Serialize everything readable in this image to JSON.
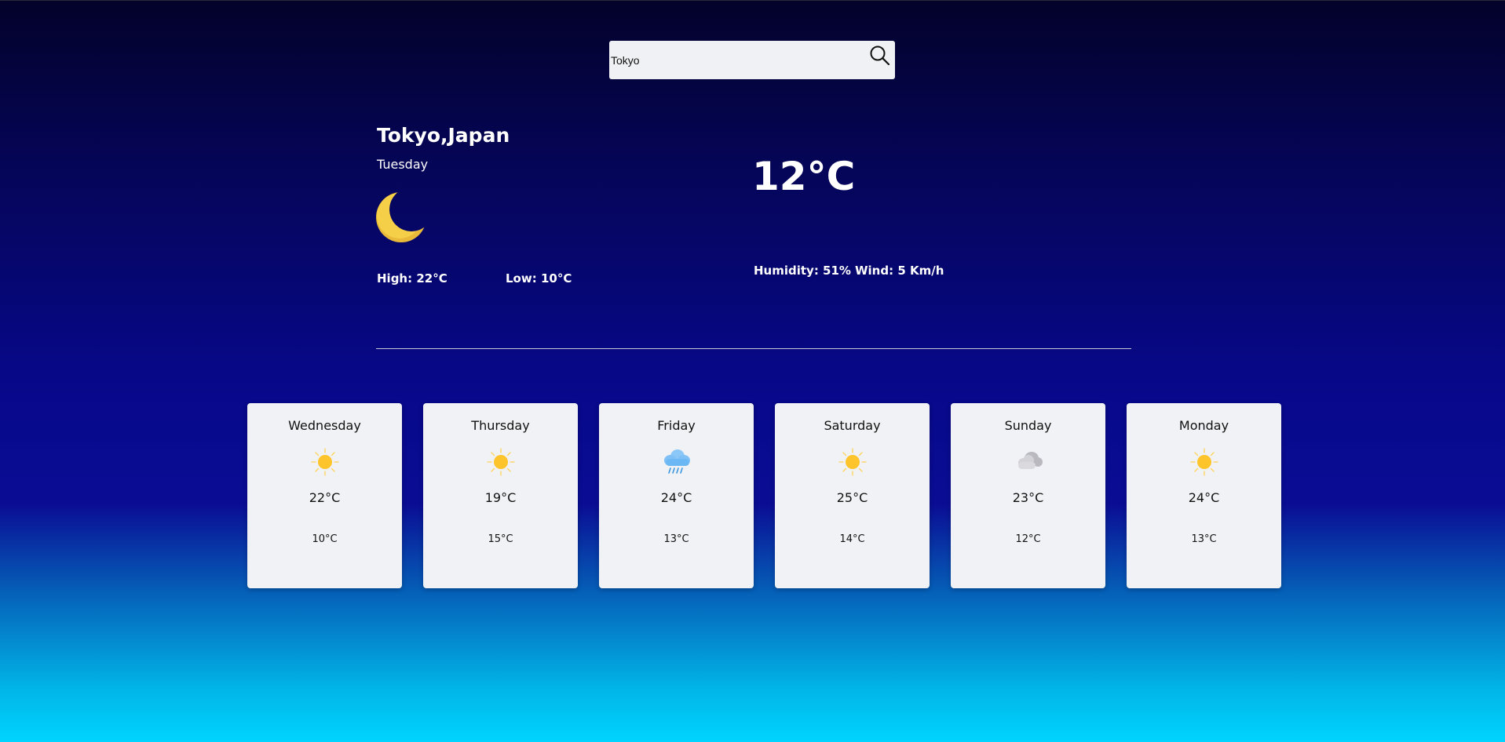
{
  "search": {
    "value": "Tokyo",
    "icon": "search-icon"
  },
  "current": {
    "location": "Tokyo,Japan",
    "day": "Tuesday",
    "icon": "moon-icon",
    "temperature": "12°C",
    "high": "High: 22°C",
    "low": "Low: 10°C",
    "humidity": "Humidity: 51%",
    "wind": "Wind: 5 Km/h"
  },
  "forecast": [
    {
      "day": "Wednesday",
      "icon": "sun-icon",
      "high": "22°C",
      "low": "10°C"
    },
    {
      "day": "Thursday",
      "icon": "sun-icon",
      "high": "19°C",
      "low": "15°C"
    },
    {
      "day": "Friday",
      "icon": "rain-cloud-icon",
      "high": "24°C",
      "low": "13°C"
    },
    {
      "day": "Saturday",
      "icon": "sun-icon",
      "high": "25°C",
      "low": "14°C"
    },
    {
      "day": "Sunday",
      "icon": "cloud-icon",
      "high": "23°C",
      "low": "12°C"
    },
    {
      "day": "Monday",
      "icon": "sun-icon",
      "high": "24°C",
      "low": "13°C"
    }
  ],
  "colors": {
    "sun": "#fdc42c",
    "moon": "#f2c94c",
    "rain_cloud": "#6cb8f5",
    "cloud": "#c7c7cc",
    "card_bg": "#f1f2f5"
  }
}
